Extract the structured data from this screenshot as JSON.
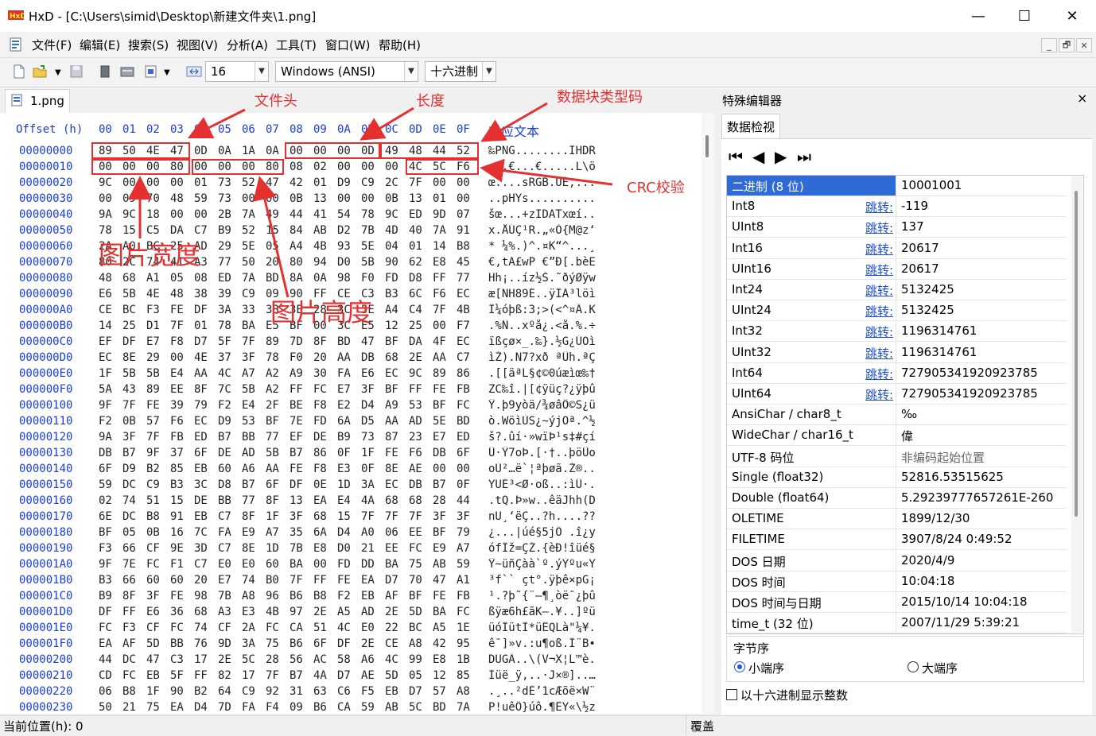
{
  "window": {
    "title": "HxD - [C:\\Users\\simid\\Desktop\\新建文件夹\\1.png]",
    "minimize": "—",
    "maximize": "☐",
    "close": "✕"
  },
  "menu": {
    "items": [
      "文件(F)",
      "编辑(E)",
      "搜索(S)",
      "视图(V)",
      "分析(A)",
      "工具(T)",
      "窗口(W)",
      "帮助(H)"
    ],
    "mdi": [
      "_",
      "🗗",
      "✕"
    ]
  },
  "toolbar": {
    "bytes_per_row": "16",
    "charset": "Windows (ANSI)",
    "offset_base": "十六进制",
    "icons": [
      "new-file-icon",
      "open-file-icon",
      "save-icon",
      "properties-icon",
      "disk-icon",
      "ram-icon",
      "columns-icon"
    ]
  },
  "tab": {
    "label": "1.png"
  },
  "hex": {
    "header_offset": "Offset (h)",
    "header_cols": [
      "00",
      "01",
      "02",
      "03",
      "04",
      "05",
      "06",
      "07",
      "08",
      "09",
      "0A",
      "0B",
      "0C",
      "0D",
      "0E",
      "0F"
    ],
    "header_text": "对应文本",
    "rows": [
      {
        "o": "00000000",
        "h": [
          "89",
          "50",
          "4E",
          "47",
          "0D",
          "0A",
          "1A",
          "0A",
          "00",
          "00",
          "00",
          "0D",
          "49",
          "48",
          "44",
          "52"
        ],
        "t": "‰PNG........IHDR"
      },
      {
        "o": "00000010",
        "h": [
          "00",
          "00",
          "00",
          "80",
          "00",
          "00",
          "00",
          "80",
          "08",
          "02",
          "00",
          "00",
          "00",
          "4C",
          "5C",
          "F6"
        ],
        "t": "...€...€.....L\\ö"
      },
      {
        "o": "00000020",
        "h": [
          "9C",
          "00",
          "00",
          "00",
          "01",
          "73",
          "52",
          "47",
          "42",
          "01",
          "D9",
          "C9",
          "2C",
          "7F",
          "00",
          "00"
        ],
        "t": "œ....sRGB.ÙÉ,..."
      },
      {
        "o": "00000030",
        "h": [
          "00",
          "09",
          "70",
          "48",
          "59",
          "73",
          "00",
          "00",
          "0B",
          "13",
          "00",
          "00",
          "0B",
          "13",
          "01",
          "00"
        ],
        "t": "..pHYs.........."
      },
      {
        "o": "00000040",
        "h": [
          "9A",
          "9C",
          "18",
          "00",
          "00",
          "2B",
          "7A",
          "49",
          "44",
          "41",
          "54",
          "78",
          "9C",
          "ED",
          "9D",
          "07"
        ],
        "t": "šœ...+zIDATxœí.."
      },
      {
        "o": "00000050",
        "h": [
          "78",
          "15",
          "C5",
          "DA",
          "C7",
          "B9",
          "52",
          "15",
          "84",
          "AB",
          "D2",
          "7B",
          "4D",
          "40",
          "7A",
          "91"
        ],
        "t": "x.ÅÚÇ¹R.„«Ò{M@z‘"
      },
      {
        "o": "00000060",
        "h": [
          "2A",
          "A0",
          "BC",
          "25",
          "AD",
          "29",
          "5E",
          "05",
          "A4",
          "4B",
          "93",
          "5E",
          "04",
          "01",
          "14",
          "B8"
        ],
        "t": "* ¼%.)^.¤K“^...¸"
      },
      {
        "o": "00000070",
        "h": [
          "80",
          "2C",
          "74",
          "41",
          "A3",
          "77",
          "50",
          "20",
          "80",
          "94",
          "D0",
          "5B",
          "90",
          "62",
          "E8",
          "45"
        ],
        "t": "€,tA£wP €”Ð[.bèE"
      },
      {
        "o": "00000080",
        "h": [
          "48",
          "68",
          "A1",
          "05",
          "08",
          "ED",
          "7A",
          "BD",
          "8A",
          "0A",
          "98",
          "F0",
          "FD",
          "D8",
          "FF",
          "77"
        ],
        "t": "Hh¡..íz½Š.˜ðýØÿw"
      },
      {
        "o": "00000090",
        "h": [
          "E6",
          "5B",
          "4E",
          "48",
          "38",
          "39",
          "C9",
          "09",
          "90",
          "FF",
          "CE",
          "C3",
          "B3",
          "6C",
          "F6",
          "EC"
        ],
        "t": "æ[NH89É..ÿÎÃ³löì"
      },
      {
        "o": "000000A0",
        "h": [
          "CE",
          "BC",
          "F3",
          "FE",
          "DF",
          "3A",
          "33",
          "3B",
          "3E",
          "28",
          "3C",
          "5E",
          "A4",
          "C4",
          "7F",
          "4B"
        ],
        "t": "Î¼óþß:3;>(<^¤Ä.K"
      },
      {
        "o": "000000B0",
        "h": [
          "14",
          "25",
          "D1",
          "7F",
          "01",
          "78",
          "BA",
          "E5",
          "BF",
          "00",
          "3C",
          "E5",
          "12",
          "25",
          "00",
          "F7"
        ],
        "t": ".%Ñ..xºå¿.<å.%.÷"
      },
      {
        "o": "000000C0",
        "h": [
          "EF",
          "DF",
          "E7",
          "F8",
          "D7",
          "5F",
          "7F",
          "89",
          "7D",
          "8F",
          "BD",
          "47",
          "BF",
          "DA",
          "4F",
          "EC"
        ],
        "t": "ïßçø×_.‰}.½G¿ÚOì"
      },
      {
        "o": "000000D0",
        "h": [
          "EC",
          "8E",
          "29",
          "00",
          "4E",
          "37",
          "3F",
          "78",
          "F0",
          "20",
          "AA",
          "DB",
          "68",
          "2E",
          "AA",
          "C7"
        ],
        "t": "ìŽ).N7?xð ªÛh.ªÇ"
      },
      {
        "o": "000000E0",
        "h": [
          "1F",
          "5B",
          "5B",
          "E4",
          "AA",
          "4C",
          "A7",
          "A2",
          "A9",
          "30",
          "FA",
          "E6",
          "EC",
          "9C",
          "89",
          "86"
        ],
        "t": ".[[äªL§¢©0úæìœ‰†"
      },
      {
        "o": "000000F0",
        "h": [
          "5A",
          "43",
          "89",
          "EE",
          "8F",
          "7C",
          "5B",
          "A2",
          "FF",
          "FC",
          "E7",
          "3F",
          "BF",
          "FF",
          "FE",
          "FB"
        ],
        "t": "ZC‰î.|[¢ÿüç?¿ÿþû"
      },
      {
        "o": "00000100",
        "h": [
          "9F",
          "7F",
          "FE",
          "39",
          "79",
          "F2",
          "E4",
          "2F",
          "BE",
          "F8",
          "E2",
          "D4",
          "A9",
          "53",
          "BF",
          "FC"
        ],
        "t": "Ÿ.þ9yòä/¾øâÔ©S¿ü"
      },
      {
        "o": "00000110",
        "h": [
          "F2",
          "0B",
          "57",
          "F6",
          "EC",
          "D9",
          "53",
          "BF",
          "7E",
          "FD",
          "6A",
          "D5",
          "AA",
          "AD",
          "5E",
          "BD"
        ],
        "t": "ò.WöìÙS¿~ýjÕª.^½"
      },
      {
        "o": "00000120",
        "h": [
          "9A",
          "3F",
          "7F",
          "FB",
          "ED",
          "B7",
          "BB",
          "77",
          "EF",
          "DE",
          "B9",
          "73",
          "87",
          "23",
          "E7",
          "ED"
        ],
        "t": "š?.ûí·»wïÞ¹s‡#çí"
      },
      {
        "o": "00000130",
        "h": [
          "DB",
          "B7",
          "9F",
          "37",
          "6F",
          "DE",
          "AD",
          "5B",
          "B7",
          "86",
          "0F",
          "1F",
          "FE",
          "F6",
          "DB",
          "6F"
        ],
        "t": "Û·Ÿ7oÞ.[·†..þöÛo"
      },
      {
        "o": "00000140",
        "h": [
          "6F",
          "D9",
          "B2",
          "85",
          "EB",
          "60",
          "A6",
          "AA",
          "FE",
          "F8",
          "E3",
          "0F",
          "8E",
          "AE",
          "00",
          "00"
        ],
        "t": "oÙ²…ë`¦ªþøã.Ž®.."
      },
      {
        "o": "00000150",
        "h": [
          "59",
          "DC",
          "C9",
          "B3",
          "3C",
          "D8",
          "B7",
          "6F",
          "DF",
          "0E",
          "1D",
          "3A",
          "EC",
          "DB",
          "B7",
          "0F"
        ],
        "t": "YÜÉ³<Ø·oß..:ìÛ·."
      },
      {
        "o": "00000160",
        "h": [
          "02",
          "74",
          "51",
          "15",
          "DE",
          "BB",
          "77",
          "8F",
          "13",
          "EA",
          "E4",
          "4A",
          "68",
          "68",
          "28",
          "44"
        ],
        "t": ".tQ.Þ»w..êäJhh(D"
      },
      {
        "o": "00000170",
        "h": [
          "6E",
          "DC",
          "B8",
          "91",
          "EB",
          "C7",
          "8F",
          "1F",
          "3F",
          "68",
          "15",
          "7F",
          "7F",
          "7F",
          "3F",
          "3F"
        ],
        "t": "nÜ¸‘ëÇ..?h....??"
      },
      {
        "o": "00000180",
        "h": [
          "BF",
          "05",
          "0B",
          "16",
          "7C",
          "FA",
          "E9",
          "A7",
          "35",
          "6A",
          "D4",
          "A0",
          "06",
          "EE",
          "BF",
          "79"
        ],
        "t": "¿...|úé§5jÔ .î¿y"
      },
      {
        "o": "00000190",
        "h": [
          "F3",
          "66",
          "CF",
          "9E",
          "3D",
          "C7",
          "8E",
          "1D",
          "7B",
          "E8",
          "D0",
          "21",
          "EE",
          "FC",
          "E9",
          "A7"
        ],
        "t": "ófÏž=ÇŽ.{èÐ!îüé§"
      },
      {
        "o": "000001A0",
        "h": [
          "9F",
          "7E",
          "FC",
          "F1",
          "C7",
          "E0",
          "E0",
          "60",
          "BA",
          "00",
          "FD",
          "DD",
          "BA",
          "75",
          "AB",
          "59"
        ],
        "t": "Ÿ~üñÇàà`º.ýÝºu«Y"
      },
      {
        "o": "000001B0",
        "h": [
          "B3",
          "66",
          "60",
          "60",
          "20",
          "E7",
          "74",
          "B0",
          "7F",
          "FF",
          "FE",
          "EA",
          "D7",
          "70",
          "47",
          "A1"
        ],
        "t": "³f`` çt°.ÿþê×pG¡"
      },
      {
        "o": "000001C0",
        "h": [
          "B9",
          "8F",
          "3F",
          "FE",
          "98",
          "7B",
          "A8",
          "96",
          "B6",
          "B8",
          "F2",
          "EB",
          "AF",
          "BF",
          "FE",
          "FB"
        ],
        "t": "¹.?þ˜{¨–¶¸òë¯¿þû"
      },
      {
        "o": "000001D0",
        "h": [
          "DF",
          "FF",
          "E6",
          "36",
          "68",
          "A3",
          "E3",
          "4B",
          "97",
          "2E",
          "A5",
          "AD",
          "2E",
          "5D",
          "BA",
          "FC"
        ],
        "t": "ßÿæ6h£ãK—.¥..]ºü"
      },
      {
        "o": "000001E0",
        "h": [
          "FC",
          "F3",
          "CF",
          "FC",
          "74",
          "CF",
          "2A",
          "FC",
          "CA",
          "51",
          "4C",
          "E0",
          "22",
          "BC",
          "A5",
          "1E"
        ],
        "t": "üóÏütÏ*üÊQLà\"¼¥."
      },
      {
        "o": "000001F0",
        "h": [
          "EA",
          "AF",
          "5D",
          "BB",
          "76",
          "9D",
          "3A",
          "75",
          "B6",
          "6F",
          "DF",
          "2E",
          "CE",
          "A8",
          "42",
          "95"
        ],
        "t": "ê¯]»v.:u¶oß.Î¨B•"
      },
      {
        "o": "00000200",
        "h": [
          "44",
          "DC",
          "47",
          "C3",
          "17",
          "2E",
          "5C",
          "28",
          "56",
          "AC",
          "58",
          "A6",
          "4C",
          "99",
          "E8",
          "1B"
        ],
        "t": "DÜGÃ..\\(V¬X¦L™è."
      },
      {
        "o": "00000210",
        "h": [
          "CD",
          "FC",
          "EB",
          "5F",
          "FF",
          "82",
          "17",
          "7F",
          "B7",
          "4A",
          "D7",
          "AE",
          "5D",
          "05",
          "12",
          "85"
        ],
        "t": "Íüë_ÿ‚..·J×®]..…"
      },
      {
        "o": "00000220",
        "h": [
          "06",
          "B8",
          "1F",
          "90",
          "B2",
          "64",
          "C9",
          "92",
          "31",
          "63",
          "C6",
          "F5",
          "EB",
          "D7",
          "57",
          "A8"
        ],
        "t": ".¸..²dÉ’1cÆõë×W¨"
      },
      {
        "o": "00000230",
        "h": [
          "50",
          "21",
          "75",
          "EA",
          "D4",
          "7D",
          "FA",
          "F4",
          "09",
          "B6",
          "CA",
          "59",
          "AB",
          "5C",
          "BD",
          "7A"
        ],
        "t": "P!uêÔ}úô.¶ÊY«\\½z"
      }
    ]
  },
  "annotations": {
    "file_header": "文件头",
    "length": "长度",
    "chunk_type": "数据块类型码",
    "crc": "CRC校验",
    "width": "图片宽度",
    "height": "图片高度"
  },
  "special_editor": {
    "title": "特殊编辑器",
    "close": "×",
    "tab": "数据检视",
    "nav": [
      "⏮",
      "◀",
      "▶",
      "⏭"
    ],
    "jump_label": "跳转:",
    "rows": [
      {
        "name": "二进制 (8 位)",
        "jump": false,
        "value": "10001001",
        "selected": true
      },
      {
        "name": "Int8",
        "jump": true,
        "value": "-119"
      },
      {
        "name": "UInt8",
        "jump": true,
        "value": "137"
      },
      {
        "name": "Int16",
        "jump": true,
        "value": "20617"
      },
      {
        "name": "UInt16",
        "jump": true,
        "value": "20617"
      },
      {
        "name": "Int24",
        "jump": true,
        "value": "5132425"
      },
      {
        "name": "UInt24",
        "jump": true,
        "value": "5132425"
      },
      {
        "name": "Int32",
        "jump": true,
        "value": "1196314761"
      },
      {
        "name": "UInt32",
        "jump": true,
        "value": "1196314761"
      },
      {
        "name": "Int64",
        "jump": true,
        "value": "727905341920923785"
      },
      {
        "name": "UInt64",
        "jump": true,
        "value": "727905341920923785"
      },
      {
        "name": "AnsiChar / char8_t",
        "jump": false,
        "value": "‰"
      },
      {
        "name": "WideChar / char16_t",
        "jump": false,
        "value": "偉"
      },
      {
        "name": "UTF-8 码位",
        "jump": false,
        "value": "非编码起始位置",
        "gray": true
      },
      {
        "name": "Single (float32)",
        "jump": false,
        "value": "52816.53515625"
      },
      {
        "name": "Double (float64)",
        "jump": false,
        "value": "5.29239777657261E-260"
      },
      {
        "name": "OLETIME",
        "jump": false,
        "value": "1899/12/30"
      },
      {
        "name": "FILETIME",
        "jump": false,
        "value": "3907/8/24 0:49:52"
      },
      {
        "name": "DOS 日期",
        "jump": false,
        "value": "2020/4/9"
      },
      {
        "name": "DOS 时间",
        "jump": false,
        "value": "10:04:18"
      },
      {
        "name": "DOS 时间与日期",
        "jump": false,
        "value": "2015/10/14 10:04:18"
      },
      {
        "name": "time_t (32 位)",
        "jump": false,
        "value": "2007/11/29 5:39:21"
      }
    ],
    "byte_order_label": "字节序",
    "little_endian": "小端序",
    "big_endian": "大端序",
    "hex_ints": "以十六进制显示整数"
  },
  "status": {
    "position": "当前位置(h): 0",
    "mode": "覆盖"
  },
  "colors": {
    "accent": "#1a3dd8",
    "annotation": "#e53030",
    "selection": "#2f6bd6"
  }
}
